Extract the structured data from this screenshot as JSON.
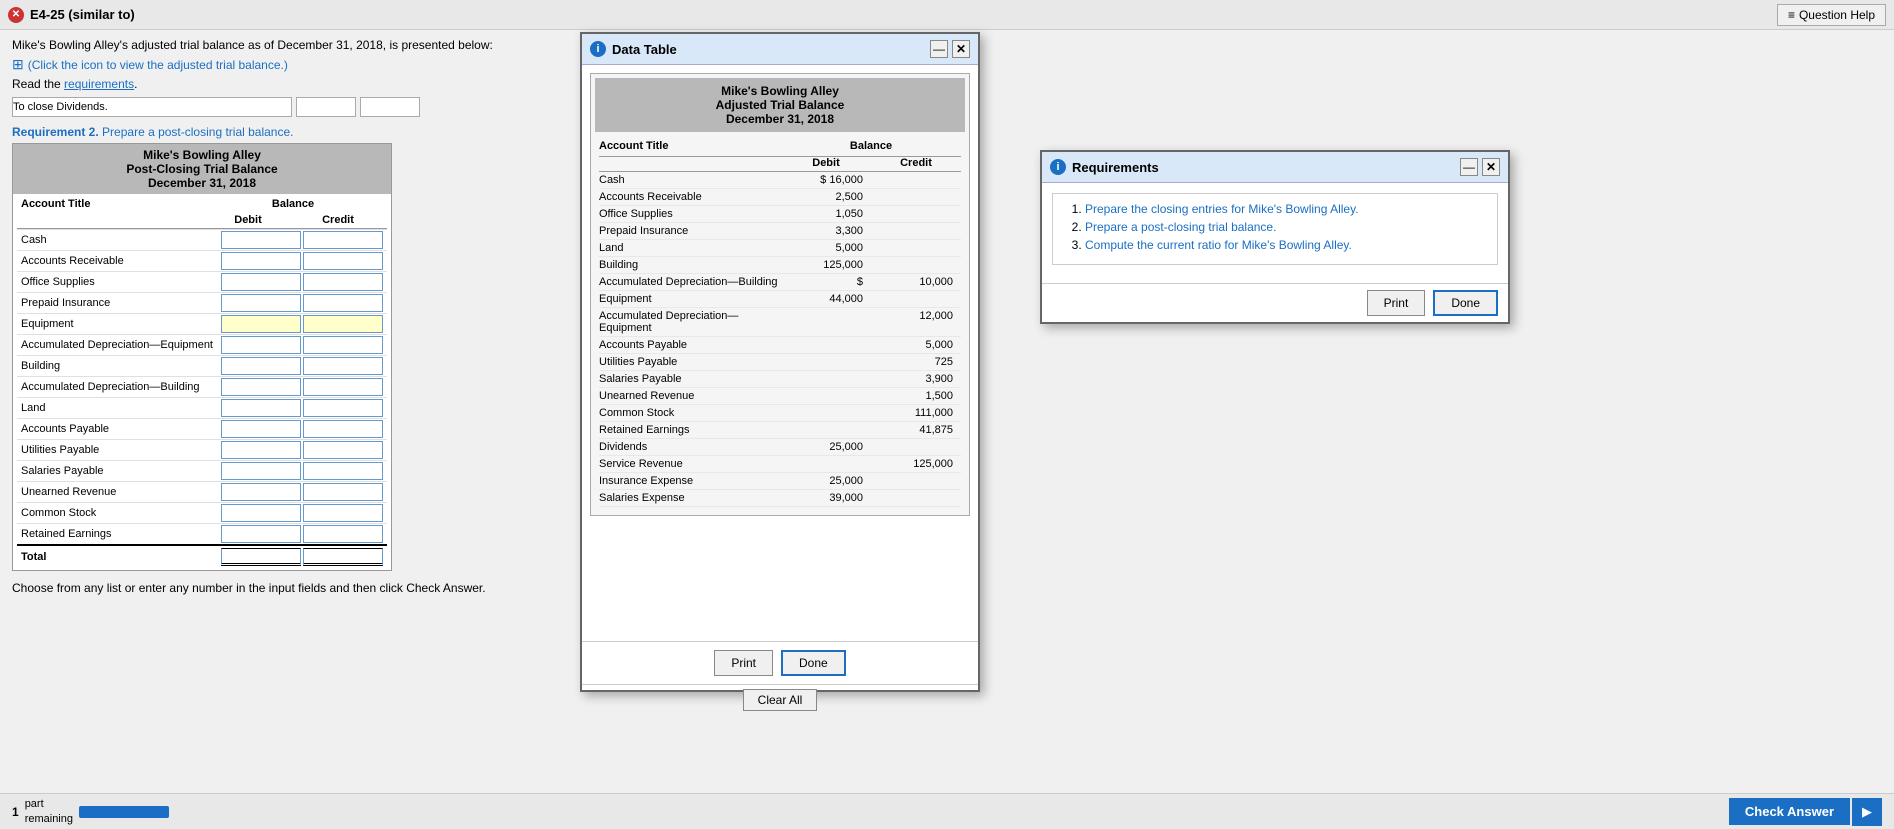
{
  "titleBar": {
    "icon": "✕",
    "title": "E4-25 (similar to)",
    "questionHelp": "Question Help"
  },
  "intro": {
    "mainText": "Mike's Bowling Alley's adjusted trial balance as of December 31, 2018, is presented below:",
    "iconText": "(Click the icon to view the adjusted trial balance.)",
    "readText": "Read the",
    "requirementsLink": "requirements",
    "periodText": "."
  },
  "journalEntry": {
    "placeholder": "To close Dividends."
  },
  "requirement2": {
    "prefix": "Requirement 2.",
    "text": " Prepare a post-closing trial balance."
  },
  "trialBalance": {
    "company": "Mike's Bowling Alley",
    "title": "Post-Closing Trial Balance",
    "date": "December 31, 2018",
    "balanceLabel": "Balance",
    "debitLabel": "Debit",
    "creditLabel": "Credit",
    "accountTitleLabel": "Account Title",
    "rows": [
      {
        "label": "Cash"
      },
      {
        "label": "Accounts Receivable"
      },
      {
        "label": "Office Supplies"
      },
      {
        "label": "Prepaid Insurance"
      },
      {
        "label": "Equipment"
      },
      {
        "label": "Accumulated Depreciation—Equipment"
      },
      {
        "label": "Building"
      },
      {
        "label": "Accumulated Depreciation—Building"
      },
      {
        "label": "Land"
      },
      {
        "label": "Accounts Payable"
      },
      {
        "label": "Utilities Payable"
      },
      {
        "label": "Salaries Payable"
      },
      {
        "label": "Unearned Revenue"
      },
      {
        "label": "Common Stock"
      },
      {
        "label": "Retained Earnings"
      }
    ],
    "totalLabel": "Total"
  },
  "bottomText": "Choose from any list or enter any number in the input fields and then click Check Answer.",
  "footer": {
    "partLabel": "1",
    "remainingLabel": "part\nremaining",
    "checkAnswer": "Check Answer"
  },
  "dataTableModal": {
    "title": "Data Table",
    "company": "Mike's Bowling Alley",
    "subtitle": "Adjusted Trial Balance",
    "date": "December 31, 2018",
    "balanceLabel": "Balance",
    "accountTitleLabel": "Account Title",
    "debitLabel": "Debit",
    "creditLabel": "Credit",
    "rows": [
      {
        "title": "Cash",
        "debit": "$ 16,000",
        "credit": ""
      },
      {
        "title": "Accounts Receivable",
        "debit": "2,500",
        "credit": ""
      },
      {
        "title": "Office Supplies",
        "debit": "1,050",
        "credit": ""
      },
      {
        "title": "Prepaid Insurance",
        "debit": "3,300",
        "credit": ""
      },
      {
        "title": "Land",
        "debit": "5,000",
        "credit": ""
      },
      {
        "title": "Building",
        "debit": "125,000",
        "credit": ""
      },
      {
        "title": "Accumulated Depreciation—Building",
        "debit": "",
        "credit": "$ 10,000"
      },
      {
        "title": "Equipment",
        "debit": "44,000",
        "credit": ""
      },
      {
        "title": "Accumulated Depreciation—Equipment",
        "debit": "",
        "credit": "12,000"
      },
      {
        "title": "Accounts Payable",
        "debit": "",
        "credit": "5,000"
      },
      {
        "title": "Utilities Payable",
        "debit": "",
        "credit": "725"
      },
      {
        "title": "Salaries Payable",
        "debit": "",
        "credit": "3,900"
      },
      {
        "title": "Unearned Revenue",
        "debit": "",
        "credit": "1,500"
      },
      {
        "title": "Common Stock",
        "debit": "",
        "credit": "111,000"
      },
      {
        "title": "Retained Earnings",
        "debit": "",
        "credit": "41,875"
      },
      {
        "title": "Dividends",
        "debit": "25,000",
        "credit": ""
      },
      {
        "title": "Service Revenue",
        "debit": "",
        "credit": "125,000"
      },
      {
        "title": "Insurance Expense",
        "debit": "25,000",
        "credit": ""
      },
      {
        "title": "Salaries Expense",
        "debit": "39,000",
        "credit": ""
      }
    ],
    "printLabel": "Print",
    "doneLabel": "Done",
    "clearAllLabel": "Clear All"
  },
  "requirementsModal": {
    "title": "Requirements",
    "items": [
      {
        "num": "1.",
        "text": "Prepare the closing entries for Mike's Bowling Alley."
      },
      {
        "num": "2.",
        "text": "Prepare a post-closing trial balance."
      },
      {
        "num": "3.",
        "text": "Compute the current ratio for Mike's Bowling Alley."
      }
    ],
    "printLabel": "Print",
    "doneLabel": "Done"
  }
}
